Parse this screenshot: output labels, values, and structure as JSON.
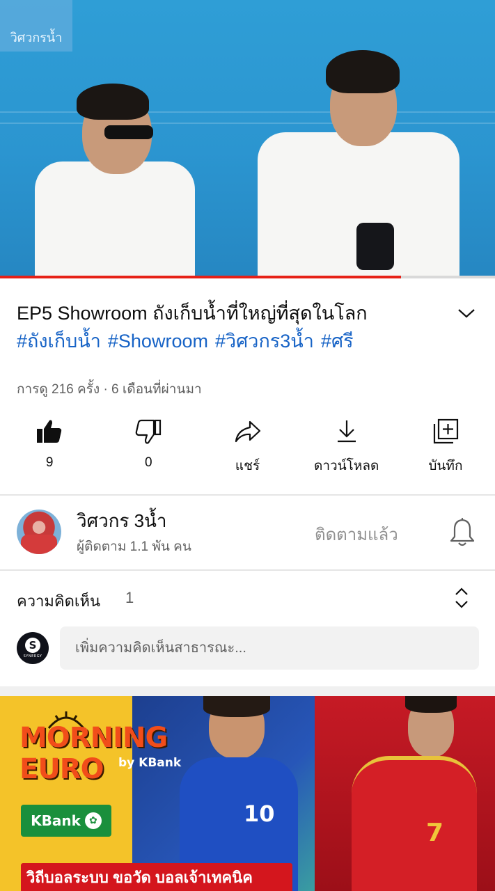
{
  "video": {
    "watermark": "วิศวกรน้ำ",
    "progress_fraction": 0.81
  },
  "details": {
    "title": "EP5 Showroom ถังเก็บน้ำที่ใหญ่ที่สุดในโลก",
    "hashtags": [
      "#ถังเก็บน้ำ",
      "#Showroom",
      "#วิศวกร3น้ำ",
      "#ศรี"
    ],
    "meta": "การดู 216 ครั้ง · 6 เดือนที่ผ่านมา",
    "expand_icon": "chevron-down-icon"
  },
  "actions": [
    {
      "id": "like",
      "icon": "thumbs-up-filled-icon",
      "label": "9"
    },
    {
      "id": "dislike",
      "icon": "thumbs-down-icon",
      "label": "0"
    },
    {
      "id": "share",
      "icon": "share-arrow-icon",
      "label": "แชร์"
    },
    {
      "id": "download",
      "icon": "download-icon",
      "label": "ดาวน์โหลด"
    },
    {
      "id": "save",
      "icon": "add-to-playlist-icon",
      "label": "บันทึก"
    }
  ],
  "channel": {
    "name": "วิศวกร 3น้ำ",
    "subscribers": "ผู้ติดตาม 1.1 พัน คน",
    "subscribe_state": "ติดตามแล้ว",
    "bell_icon": "bell-icon"
  },
  "comments": {
    "title": "ความคิดเห็น",
    "count": "1",
    "sort_icon": "expand-collapse-icon",
    "input_placeholder": "เพิ่มความคิดเห็นสาธารณะ...",
    "user_avatar_letter": "S",
    "user_avatar_text": "SYNERGY"
  },
  "ad": {
    "line1": "MORNING",
    "line2": "EURO",
    "by": "by KBank",
    "badge": "KBank",
    "strip": "วิถีบอลระบบ ขอวัด บอลเจ้าเทคนิค",
    "jersey_left": "10",
    "jersey_right": "7",
    "colors": {
      "yellow": "#f4c329",
      "blue": "#2756b8",
      "red": "#c61a25",
      "kbank_green": "#1a8f3c"
    }
  }
}
